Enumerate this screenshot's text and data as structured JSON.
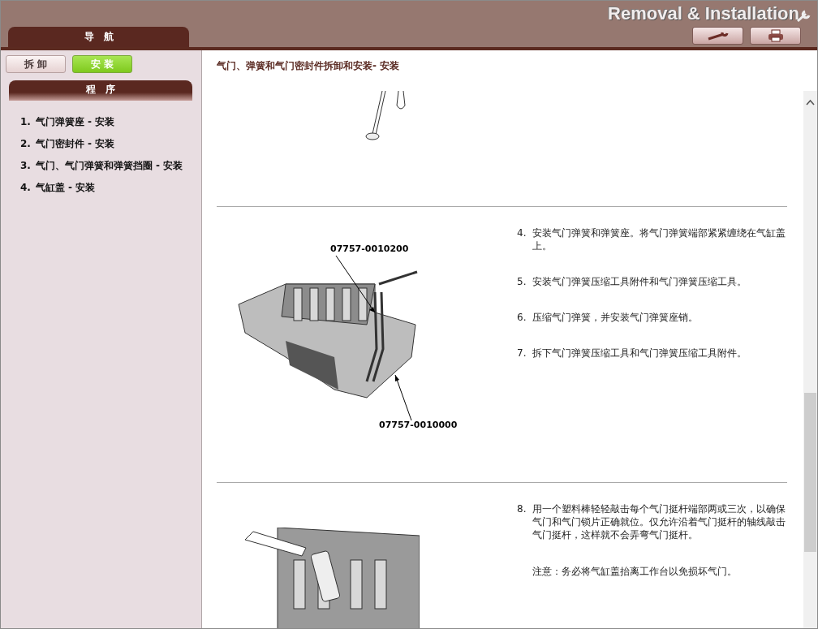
{
  "header": {
    "title": "Removal & Installation",
    "nav_tab": "导　航"
  },
  "mode_tabs": [
    {
      "label": "拆 卸",
      "selected": false
    },
    {
      "label": "安 装",
      "selected": true
    }
  ],
  "procedure_header": "程　序",
  "procedures": [
    {
      "number": "1.",
      "label": "气门弹簧座 - 安装"
    },
    {
      "number": "2.",
      "label": "气门密封件 - 安装"
    },
    {
      "number": "3.",
      "label": "气门、气门弹簧和弹簧挡圈 - 安装"
    },
    {
      "number": "4.",
      "label": "气缸盖 - 安装"
    }
  ],
  "content": {
    "title": "气门、弹簧和气门密封件拆卸和安装- 安装",
    "sections": [
      {
        "kind": "valves"
      },
      {
        "kind": "spring-tool",
        "figure_labels": [
          "07757-0010200",
          "07757-0010000"
        ],
        "steps": [
          {
            "number": "4.",
            "text": "安装气门弹簧和弹簧座。将气门弹簧端部紧紧缠绕在气缸盖上。"
          },
          {
            "number": "5.",
            "text": "安装气门弹簧压缩工具附件和气门弹簧压缩工具。"
          },
          {
            "number": "6.",
            "text": "压缩气门弹簧，并安装气门弹簧座销。"
          },
          {
            "number": "7.",
            "text": "拆下气门弹簧压缩工具和气门弹簧压缩工具附件。"
          }
        ]
      },
      {
        "kind": "mallet",
        "steps": [
          {
            "number": "8.",
            "text": "用一个塑料棒轻轻敲击每个气门挺杆端部两或三次，以确保气门和气门锁片正确就位。仅允许沿着气门挺杆的轴线敲击气门挺杆，这样就不会弄弯气门挺杆。"
          }
        ],
        "note": "注意：务必将气缸盖抬离工作台以免损坏气门。"
      }
    ]
  }
}
